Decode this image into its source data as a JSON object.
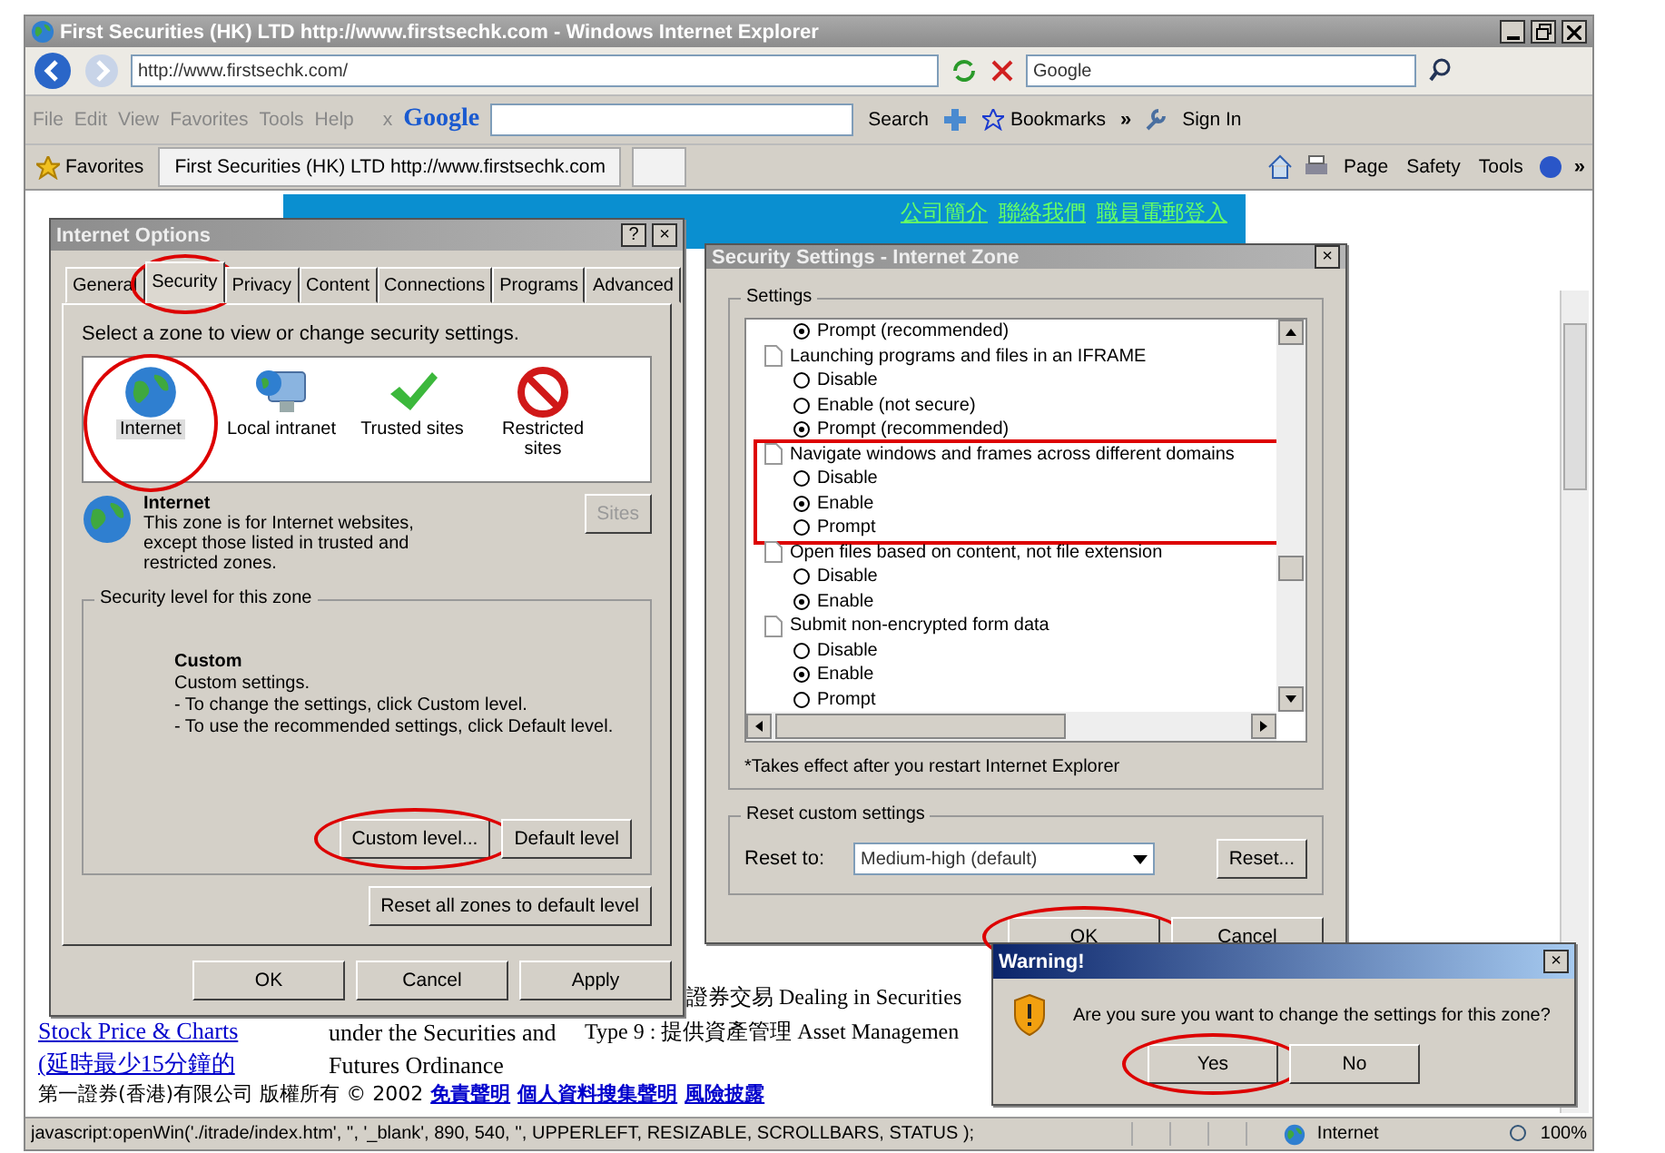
{
  "window": {
    "title": "First Securities (HK) LTD   http://www.firstsechk.com - Windows Internet Explorer"
  },
  "address_bar": {
    "value": "http://www.firstsechk.com/",
    "search_placeholder": "Google"
  },
  "google_toolbar": {
    "menu": [
      "File",
      "Edit",
      "View",
      "Favorites",
      "Tools",
      "Help"
    ],
    "close": "x",
    "logo": "Google",
    "search": "Search",
    "bookmarks": "Bookmarks",
    "more": "»",
    "sign_in": "Sign In"
  },
  "favorites_bar": {
    "favorites": "Favorites",
    "tab": "First Securities (HK) LTD   http://www.firstsechk.com",
    "commands": [
      "Page",
      "Safety",
      "Tools"
    ],
    "more": "»"
  },
  "web_page": {
    "nav_links": [
      "公司簡介",
      "聯絡我們",
      "職員電郵登入"
    ],
    "bottom_left": [
      "Stock Price & Charts",
      "(延時最少15分鐘的"
    ],
    "bottom_middle": [
      "under the Securities and",
      "Futures Ordinance"
    ],
    "bottom_right": [
      "證券交易 Dealing in Securities",
      "Type 9 : 提供資產管理 Asset Managemen"
    ],
    "footer": "第一證券(香港)有限公司 版權所有 © 2002",
    "footer_links": [
      "免責聲明",
      "個人資料搜集聲明",
      "風險披露"
    ]
  },
  "internet_options": {
    "title": "Internet Options",
    "help": "?",
    "close": "×",
    "tabs": [
      {
        "label": "General",
        "selected": false,
        "circled": false
      },
      {
        "label": "Security",
        "selected": true,
        "circled": true
      },
      {
        "label": "Privacy",
        "selected": false,
        "circled": false
      },
      {
        "label": "Content",
        "selected": false,
        "circled": false
      },
      {
        "label": "Connections",
        "selected": false,
        "circled": false
      },
      {
        "label": "Programs",
        "selected": false,
        "circled": false
      },
      {
        "label": "Advanced",
        "selected": false,
        "circled": false
      }
    ],
    "zone_prompt": "Select a zone to view or change security settings.",
    "zones": [
      {
        "label": "Internet",
        "kind": "globe",
        "selected": true,
        "circled": true
      },
      {
        "label": "Local intranet",
        "kind": "computer",
        "selected": false,
        "circled": false
      },
      {
        "label": "Trusted sites",
        "kind": "check",
        "selected": false,
        "circled": false
      },
      {
        "label": "Restricted sites",
        "kind": "blocked",
        "selected": false,
        "circled": false
      }
    ],
    "zone_name": "Internet",
    "zone_description": "This zone is for Internet websites, except those listed in trusted and restricted zones.",
    "sites_button": {
      "label": "Sites",
      "disabled": true,
      "circled": false
    },
    "level_group": "Security level for this zone",
    "level_name": "Custom",
    "level_lines": [
      "Custom settings.",
      "- To change the settings, click Custom level.",
      "- To use the recommended settings, click Default level."
    ],
    "level_buttons": [
      {
        "label": "Custom level...",
        "disabled": false,
        "circled": true
      },
      {
        "label": "Default level",
        "disabled": false,
        "circled": false
      }
    ],
    "reset_all": {
      "label": "Reset all zones to default level",
      "disabled": false,
      "circled": false
    },
    "buttons": [
      {
        "label": "OK",
        "disabled": false,
        "circled": false
      },
      {
        "label": "Cancel",
        "disabled": false,
        "circled": false
      },
      {
        "label": "Apply",
        "disabled": false,
        "circled": false
      }
    ]
  },
  "security_settings": {
    "title": "Security Settings - Internet Zone",
    "close": "×",
    "settings_group": "Settings",
    "groups": [
      {
        "highlighted": false,
        "options": [
          {
            "label": "Prompt (recommended)",
            "selected": true
          }
        ]
      },
      {
        "label": "Launching programs and files in an IFRAME",
        "highlighted": false,
        "options": [
          {
            "label": "Disable",
            "selected": false
          },
          {
            "label": "Enable (not secure)",
            "selected": false
          },
          {
            "label": "Prompt (recommended)",
            "selected": true
          }
        ]
      },
      {
        "label": "Navigate windows and frames across different domains",
        "highlighted": true,
        "options": [
          {
            "label": "Disable",
            "selected": false
          },
          {
            "label": "Enable",
            "selected": true
          },
          {
            "label": "Prompt",
            "selected": false
          }
        ]
      },
      {
        "label": "Open files based on content, not file extension",
        "highlighted": false,
        "options": [
          {
            "label": "Disable",
            "selected": false
          },
          {
            "label": "Enable",
            "selected": true
          }
        ]
      },
      {
        "label": "Submit non-encrypted form data",
        "highlighted": false,
        "options": [
          {
            "label": "Disable",
            "selected": false
          },
          {
            "label": "Enable",
            "selected": true
          },
          {
            "label": "Prompt",
            "selected": false
          }
        ]
      }
    ],
    "note": "*Takes effect after you restart Internet Explorer",
    "reset_group": "Reset custom settings",
    "reset_label": "Reset to:",
    "reset_value": "Medium-high (default)",
    "reset_button": {
      "label": "Reset...",
      "disabled": false,
      "circled": false
    },
    "buttons": [
      {
        "label": "OK",
        "disabled": false,
        "circled": true
      },
      {
        "label": "Cancel",
        "disabled": false,
        "circled": false
      }
    ]
  },
  "warning": {
    "title": "Warning!",
    "close": "×",
    "message": "Are you sure you want to change the settings for this zone?",
    "buttons": [
      {
        "label": "Yes",
        "disabled": false,
        "circled": true
      },
      {
        "label": "No",
        "disabled": false,
        "circled": false
      }
    ]
  },
  "status_bar": {
    "text": "javascript:openWin('./itrade/index.htm', '', '_blank', 890, 540, '', UPPERLEFT, RESIZABLE, SCROLLBARS, STATUS );",
    "zone": "Internet",
    "zoom": "100%"
  }
}
